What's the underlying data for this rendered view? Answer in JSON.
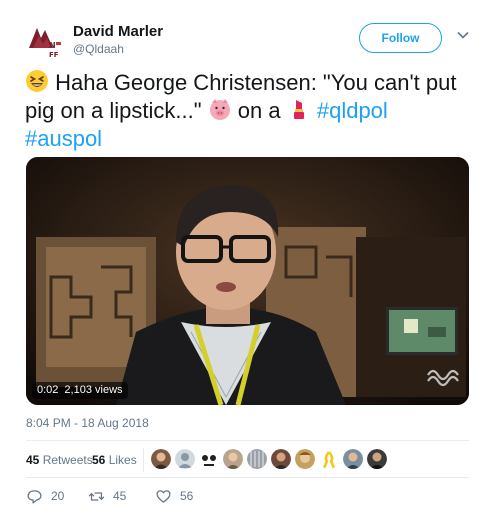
{
  "author": {
    "name": "David Marler",
    "handle": "@Qldaah",
    "avatar_icon": "party-logo-icon"
  },
  "follow_button": {
    "label": "Follow"
  },
  "tweet": {
    "lead_emoji": "grinning-squinting-face-emoji",
    "text_part1": " Haha George Christensen: \"You can't put pig on a lipstick...\" ",
    "pig_emoji": "pig-face-emoji",
    "text_part2": " on a ",
    "lipstick_emoji": "lipstick-emoji",
    "hashtags": [
      "#qldpol",
      "#auspol"
    ]
  },
  "video": {
    "duration": "0:02",
    "views": "2,103 views",
    "watermark": "ABC"
  },
  "timestamp": "8:04 PM - 18 Aug 2018",
  "stats": {
    "retweets_count": "45",
    "retweets_label": "Retweets",
    "likes_count": "56",
    "likes_label": "Likes",
    "likers": [
      "liker-avatar-1",
      "liker-avatar-2",
      "liker-avatar-3",
      "liker-avatar-4",
      "liker-avatar-5",
      "liker-avatar-6",
      "liker-avatar-7",
      "liker-avatar-8",
      "liker-avatar-9",
      "liker-avatar-10"
    ]
  },
  "actions": {
    "replies": "20",
    "retweets": "45",
    "likes": "56"
  },
  "colors": {
    "accent": "#1da1f2",
    "text": "#14171a",
    "muted": "#657786",
    "divider": "#e6ecf0"
  }
}
